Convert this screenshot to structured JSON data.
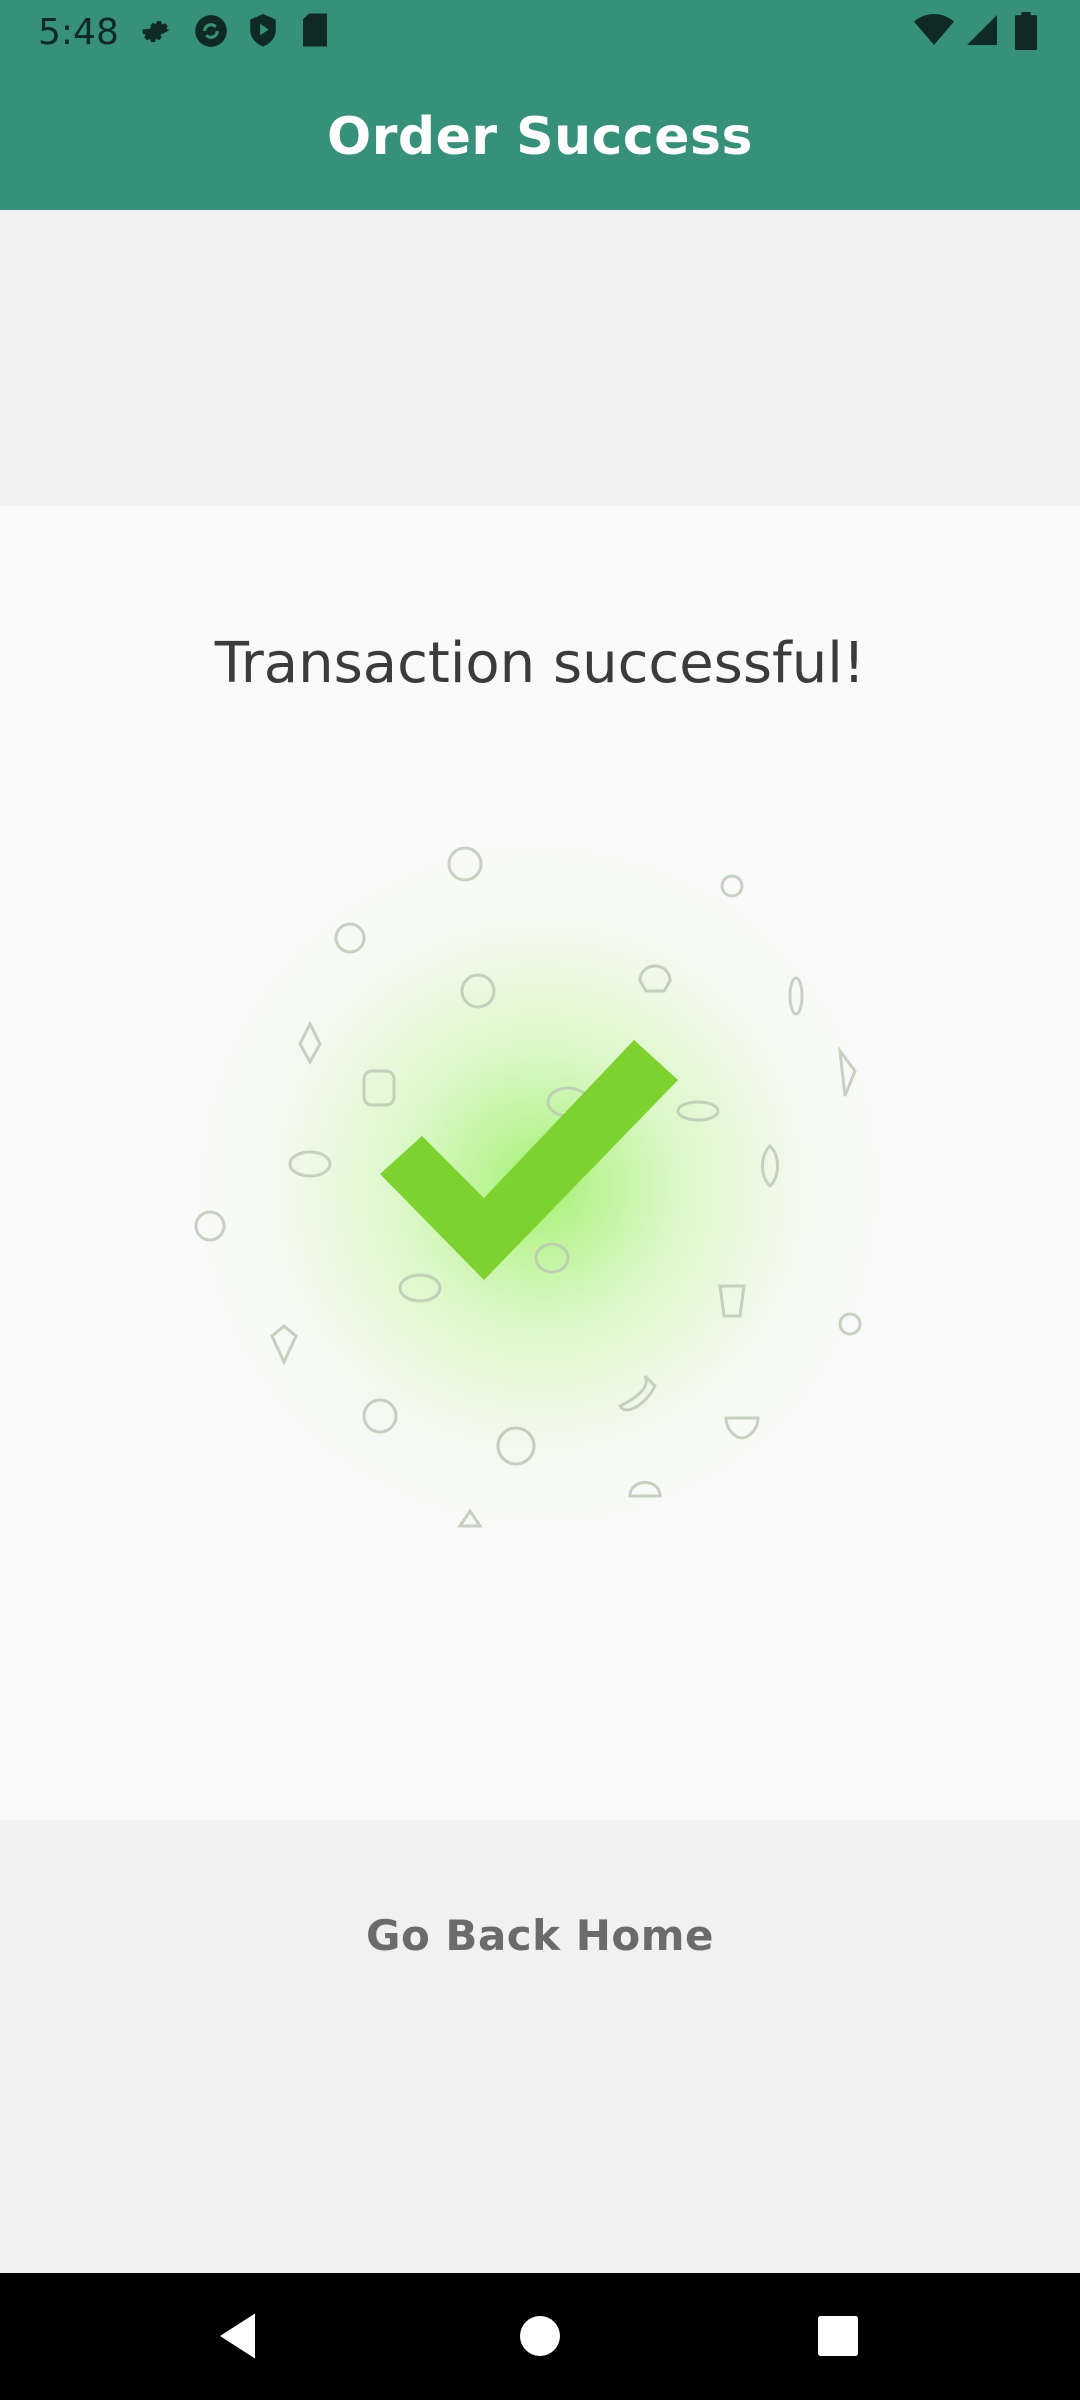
{
  "status_bar": {
    "time": "5:48",
    "left_icons": [
      "settings-icon",
      "sync-icon",
      "shield-play-icon",
      "sd-card-icon"
    ],
    "right_icons": [
      "wifi-icon",
      "signal-icon",
      "battery-icon"
    ]
  },
  "app_bar": {
    "title": "Order Success"
  },
  "content": {
    "heading": "Transaction successful!",
    "graphic": "checkmark-with-vegetables-icon"
  },
  "actions": {
    "go_home_label": "Go Back Home"
  },
  "nav": {
    "buttons": [
      "back-icon",
      "home-icon",
      "recents-icon"
    ]
  },
  "colors": {
    "primary": "#37917a",
    "check": "#7ed22f",
    "text_dark": "#3b3b3b",
    "text_muted": "#6b6b6b"
  }
}
